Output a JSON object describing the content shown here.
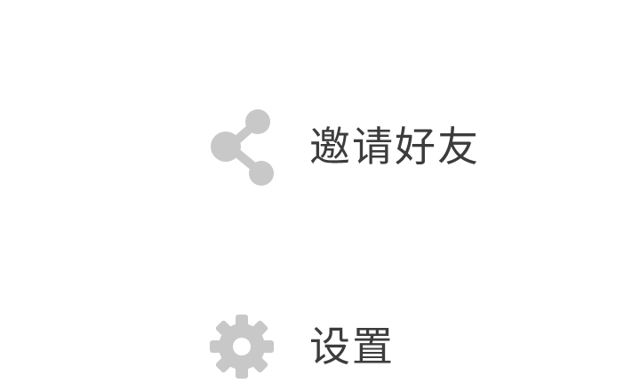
{
  "menu": {
    "items": [
      {
        "label": "邀请好友",
        "icon": "share-icon"
      },
      {
        "label": "设置",
        "icon": "gear-icon"
      }
    ]
  },
  "colors": {
    "icon": "#c8c8c8",
    "text": "#3c3c3c",
    "background": "#ffffff"
  }
}
